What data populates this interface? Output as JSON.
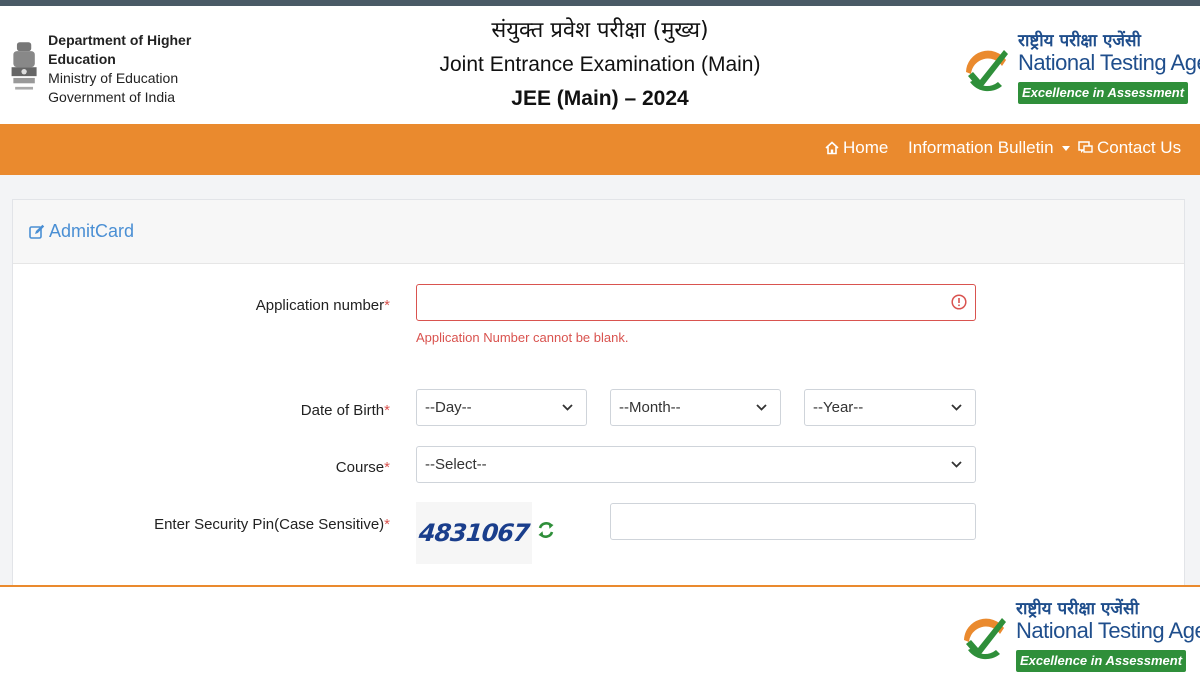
{
  "header": {
    "dhe_line1": "Department of Higher Education",
    "dhe_line2": "Ministry of Education",
    "dhe_line3": "Government of India",
    "title_hindi": "संयुक्त प्रवेश परीक्षा (मुख्य)",
    "title_english": "Joint Entrance Examination (Main)",
    "title_year": "JEE (Main) – 2024"
  },
  "nta_logo": {
    "hindi": "राष्ट्रीय परीक्षा एजेंसी",
    "english": "National Testing Agency",
    "tagline": "Excellence in Assessment"
  },
  "nav": {
    "home": "Home",
    "bulletin": "Information Bulletin",
    "contact": "Contact Us"
  },
  "card": {
    "title": "AdmitCard"
  },
  "form": {
    "app_label": "Application number",
    "app_value": "",
    "app_error": "Application Number cannot be blank.",
    "dob_label": "Date of Birth",
    "day": "--Day--",
    "month": "--Month--",
    "year": "--Year--",
    "course_label": "Course",
    "course": "--Select--",
    "pin_label": "Enter Security Pin(Case Sensitive)",
    "captcha": "4831067",
    "pin_value": "",
    "required_mark": "*"
  },
  "colors": {
    "nav_orange": "#ea8a2e",
    "accent_blue": "#4a8fd4",
    "error_red": "#d9534f",
    "nta_green": "#2f8f3a"
  }
}
